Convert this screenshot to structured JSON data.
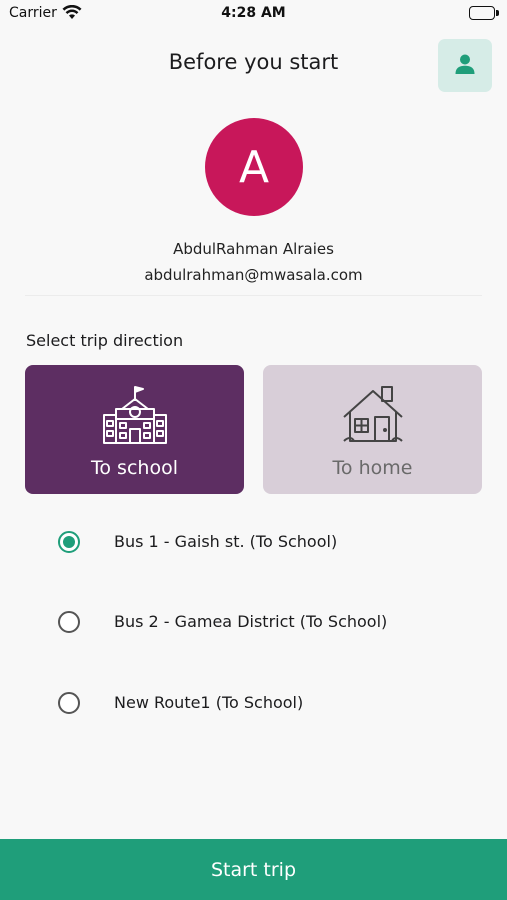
{
  "status_bar": {
    "carrier": "Carrier",
    "time": "4:28 AM"
  },
  "header": {
    "title": "Before you start",
    "profile_icon": "person-icon"
  },
  "user": {
    "avatar_letter": "A",
    "avatar_color": "#c8175a",
    "name": "AbdulRahman Alraies",
    "email": "abdulrahman@mwasala.com"
  },
  "trip": {
    "section_label": "Select trip direction",
    "directions": [
      {
        "label": "To school",
        "icon": "school-icon",
        "selected": true
      },
      {
        "label": "To home",
        "icon": "house-icon",
        "selected": false
      }
    ],
    "routes": [
      {
        "label": "Bus 1 - Gaish st. (To School)",
        "selected": true
      },
      {
        "label": "Bus 2 - Gamea District (To School)",
        "selected": false
      },
      {
        "label": "New Route1 (To School)",
        "selected": false
      }
    ]
  },
  "actions": {
    "start_label": "Start trip"
  },
  "colors": {
    "accent": "#1f9e7a",
    "selected_card": "#5d2e62",
    "unselected_card": "#d8ced8"
  }
}
